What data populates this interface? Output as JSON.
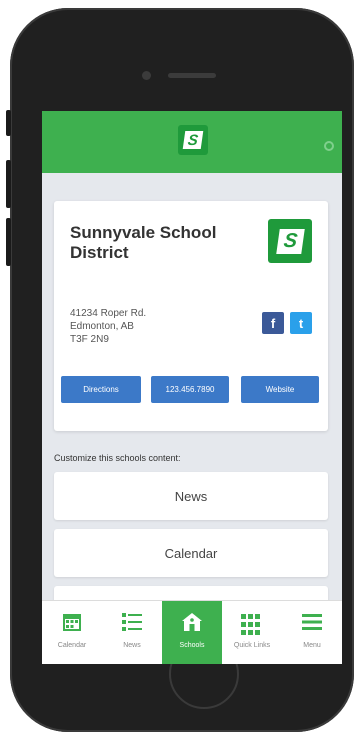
{
  "app": {
    "brand_logo_letter": "S",
    "accent_color": "#3eb04f"
  },
  "school": {
    "name": "Sunnyvale School District",
    "address_line1": "41234 Roper Rd.",
    "address_line2": "Edmonton, AB",
    "address_line3": "T3F 2N9"
  },
  "social": {
    "facebook_label": "f",
    "twitter_label": "t"
  },
  "actions": {
    "directions": "Directions",
    "phone": "123.456.7890",
    "website": "Website"
  },
  "customize": {
    "heading": "Customize this schools content:",
    "items": [
      "News",
      "Calendar"
    ]
  },
  "nav": {
    "items": [
      {
        "label": "Calendar",
        "icon": "calendar-icon"
      },
      {
        "label": "News",
        "icon": "list-icon"
      },
      {
        "label": "Schools",
        "icon": "school-icon"
      },
      {
        "label": "Quick Links",
        "icon": "grid-icon"
      },
      {
        "label": "Menu",
        "icon": "menu-icon"
      }
    ],
    "active": "Schools"
  }
}
